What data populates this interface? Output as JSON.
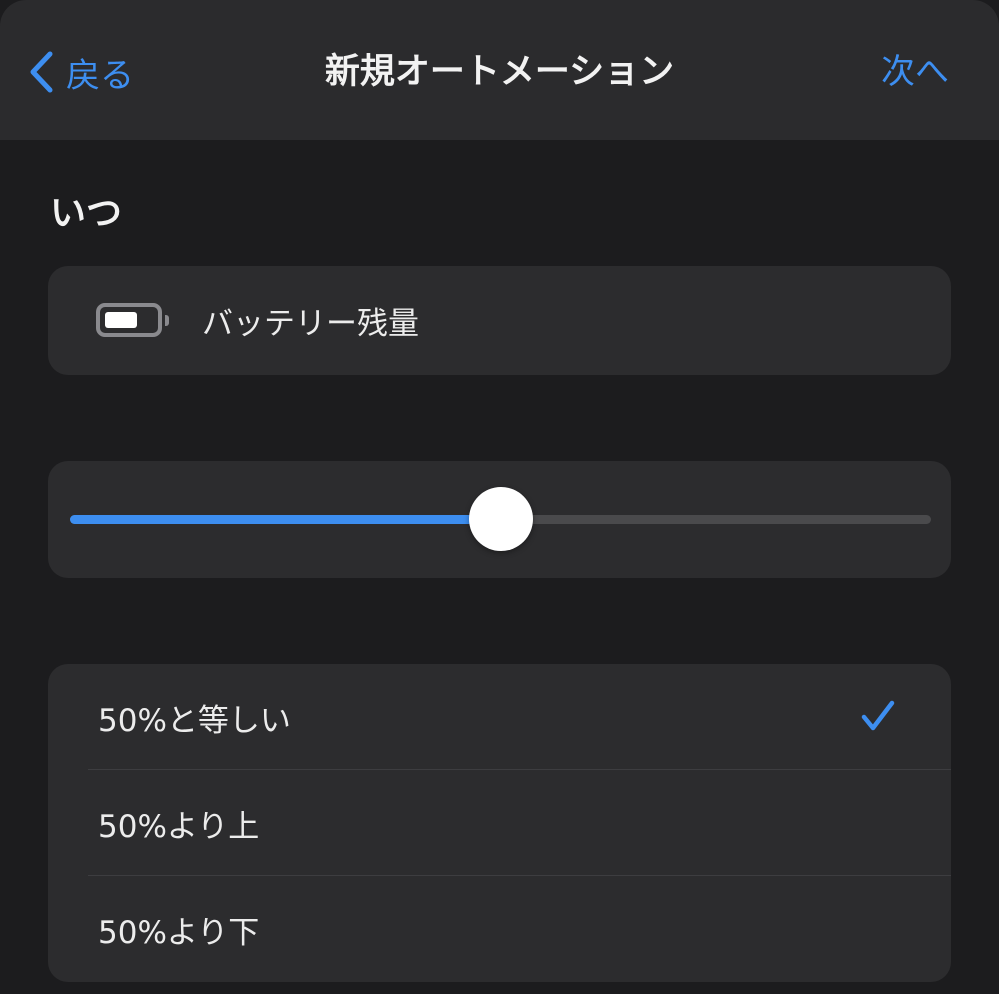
{
  "header": {
    "back_label": "戻る",
    "title": "新規オートメーション",
    "next_label": "次へ"
  },
  "section": {
    "heading": "いつ"
  },
  "trigger": {
    "icon": "battery-icon",
    "label": "バッテリー残量"
  },
  "slider": {
    "value_percent": 50
  },
  "options": [
    {
      "label": "50%と等しい",
      "selected": true
    },
    {
      "label": "50%より上",
      "selected": false
    },
    {
      "label": "50%より下",
      "selected": false
    }
  ],
  "colors": {
    "accent": "#3d8ef0",
    "background": "#1c1c1e",
    "header_background": "#2b2b2d",
    "card_background": "#2c2c2e"
  }
}
